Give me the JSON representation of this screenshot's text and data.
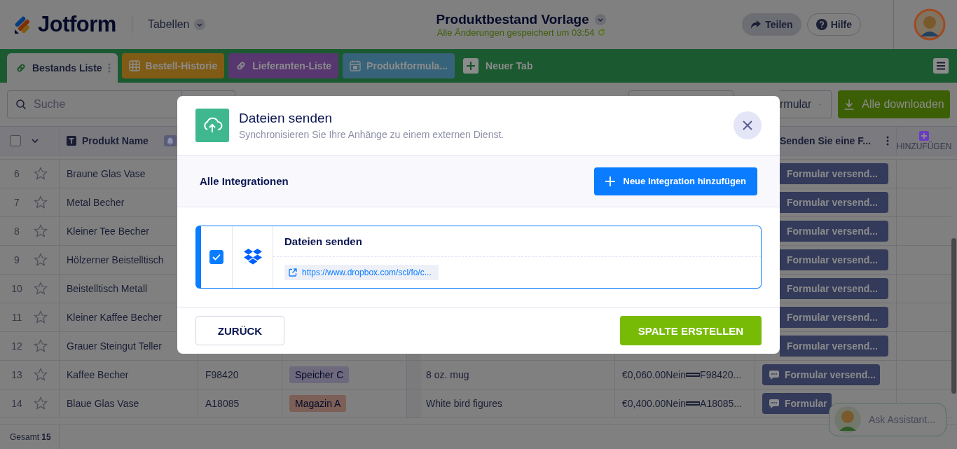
{
  "header": {
    "logo": "Jotform",
    "section": "Tabellen",
    "title": "Produktbestand Vorlage",
    "save_status": "Alle Änderungen gespeichert um 03:54",
    "share": "Teilen",
    "help": "Hilfe"
  },
  "tabs": [
    {
      "label": "Bestands Liste",
      "kind": "linked",
      "selected": true
    },
    {
      "label": "Bestell-Historie",
      "kind": "table",
      "selected": false,
      "color": "#805b15"
    },
    {
      "label": "Lieferanten-Liste",
      "kind": "linked",
      "selected": false,
      "color": "#583770"
    },
    {
      "label": "Produktformula...",
      "kind": "form",
      "selected": false,
      "color": "#366379"
    }
  ],
  "new_tab": "Neuer Tab",
  "toolbar": {
    "search_placeholder": "Suche",
    "form_button": "rmular",
    "download_button": "Alle downloaden"
  },
  "table": {
    "select_all": false,
    "name_column": "Produkt Name",
    "action_column": "Senden Sie eine F...",
    "add_column": "HINZUFÜGEN",
    "rows": [
      {
        "number": "6",
        "starred": false,
        "name": "Braune Glas Vase",
        "action": "Formular versend..."
      },
      {
        "number": "7",
        "starred": false,
        "name": "Metal Becher",
        "action": "Formular versend..."
      },
      {
        "number": "8",
        "starred": false,
        "name": "Kleiner Tee Becher",
        "action": "Formular versend..."
      },
      {
        "number": "9",
        "starred": false,
        "name": "Hölzerner Beistelltisch",
        "action": "Formular versend..."
      },
      {
        "number": "10",
        "starred": false,
        "name": "Beistelltisch Metall",
        "action": "Formular versend..."
      },
      {
        "number": "11",
        "starred": false,
        "name": "Kleiner Kaffee Becher",
        "action": "Formular versend..."
      },
      {
        "number": "12",
        "starred": false,
        "name": "Grauer Steingut Teller",
        "action": "Formular versend..."
      },
      {
        "number": "13",
        "starred": false,
        "name": "Kaffee Becher",
        "code": "F98420",
        "tag": "Speicher C",
        "color": "#6e697d",
        "description": "8 oz. mug",
        "price": "€0,060.00",
        "flag": "Nein",
        "ref": "F98420...",
        "action": "Formular versend..."
      },
      {
        "number": "14",
        "starred": false,
        "name": "Blaue Glas Vase",
        "code": "A18085",
        "tag": "Magazin A",
        "color": "#7c5f57",
        "description": "White bird figures",
        "price": "€0,400.00",
        "flag": "Nein",
        "ref": "A18085...",
        "action": "Formular"
      }
    ],
    "total": "Gesamt **15**"
  },
  "assistant": "Ask Assistant...",
  "modal": {
    "title": "Dateien senden",
    "subtitle": "Synchronisieren Sie Ihre Anhänge zu einem externen Dienst.",
    "section": "Alle Integrationen",
    "add_button": "Neue Integration hinzufügen",
    "integrations": [
      {
        "title": "Dateien senden",
        "url": "https://www.dropbox.com/scl/fo/c...",
        "checked": true
      }
    ],
    "back_button": "ZURÜCK",
    "create_button": "SPALTE ERSTELLEN"
  }
}
